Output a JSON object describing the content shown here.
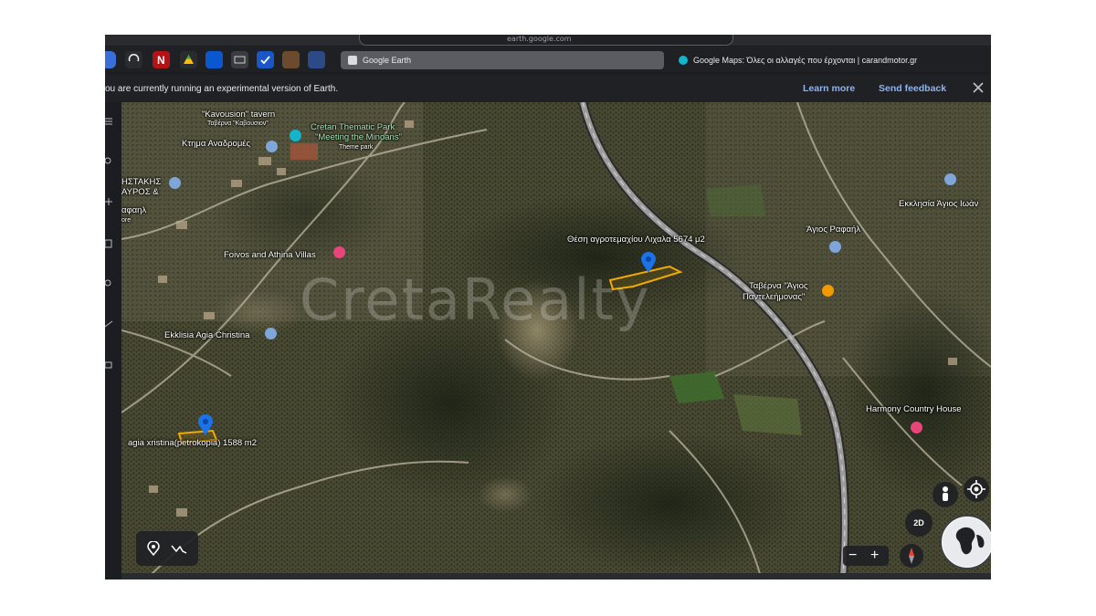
{
  "browser": {
    "address_text": "earth.google.com",
    "tabs": [
      {
        "label": "Google Earth",
        "active": true
      },
      {
        "label": "Google Maps: Όλες οι αλλαγές που έρχονται | carandmotor.gr",
        "active": false
      }
    ]
  },
  "banner": {
    "message": "ou are currently running an experimental version of Earth.",
    "learn_more": "Learn more",
    "send_feedback": "Send feedback"
  },
  "map": {
    "watermark": "CretaRealty",
    "labels": {
      "kavousion": "\"Kavousion\" tavern",
      "kavousion_sub": "Ταβέρνα \"Καβουσιον\"",
      "ktima": "Κτημα Αναδρομές",
      "cretan_park_1": "Cretan Thematic Park",
      "cretan_park_2": "\"Meeting the Minoans\"",
      "theme_park": "Theme park",
      "partial_1": "ΗΣΤΑΚΗΣ",
      "partial_2": "ΑΥΡΟΣ &",
      "partial_3": "αφαηλ",
      "partial_4": "ore",
      "foivos": "Foivos and Athina Villas",
      "ekklisia_christina": "Ekklisia Agia Christina",
      "plot_lichala": "Θέση αγροτεμαχίου Λιχαλα 5674 μ2",
      "ekklisia_ioann": "Εκκλησία Άγιος Ιωάν",
      "agios_rafail": "Άγιος Ραφαήλ",
      "taverna_1": "Ταβέρνα \"Άγιος",
      "taverna_2": "Παντελεήμονας\"",
      "plot_agia": "agia xristina(petrokopia) 1588 m2",
      "harmony": "Harmony Country House"
    },
    "controls": {
      "view_2d": "2D",
      "zoom_out": "−",
      "zoom_in": "+"
    },
    "icons": [
      "place-pin-icon",
      "path-measure-icon",
      "pegman-icon",
      "my-location-icon",
      "compass-icon",
      "globe-icon",
      "blue-marker-icon",
      "church-icon",
      "hotel-icon",
      "restaurant-icon",
      "park-icon"
    ]
  },
  "colors": {
    "banner_bg": "#202124",
    "link": "#8ab4f8",
    "marker_blue": "#1a73e8",
    "plot_outline": "#f2a900",
    "hotel_pink": "#e8457a",
    "church_blue": "#7ea6d8",
    "restaurant_orange": "#f29900",
    "park_teal": "#12b5cb"
  }
}
